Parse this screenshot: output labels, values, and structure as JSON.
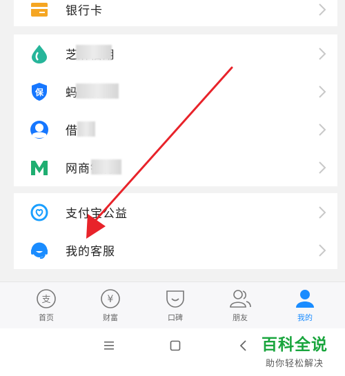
{
  "colors": {
    "accent": "#1a8cff",
    "arrow": "#e8232a",
    "watermark_green": "#19a53d"
  },
  "top_item": {
    "label": "银行卡",
    "icon": "bank-card-icon"
  },
  "services": [
    {
      "label": "芝麻信用",
      "icon": "sesame-credit-icon",
      "partially_obscured": true
    },
    {
      "label": "蚂蚁保险",
      "icon": "insurance-shield-icon",
      "partially_obscured": true
    },
    {
      "label": "借呗",
      "icon": "jiebei-icon",
      "partially_obscured": true
    },
    {
      "label": "网商银行",
      "icon": "mybank-icon",
      "partially_obscured": true
    }
  ],
  "support": [
    {
      "label": "支付宝公益",
      "icon": "charity-icon"
    },
    {
      "label": "我的客服",
      "icon": "customer-service-icon"
    }
  ],
  "tabbar": [
    {
      "label": "首页",
      "icon": "home-tab-icon",
      "active": false
    },
    {
      "label": "财富",
      "icon": "wealth-tab-icon",
      "active": false
    },
    {
      "label": "口碑",
      "icon": "koubei-tab-icon",
      "active": false
    },
    {
      "label": "朋友",
      "icon": "friends-tab-icon",
      "active": false
    },
    {
      "label": "我的",
      "icon": "me-tab-icon",
      "active": true
    }
  ],
  "system_nav": [
    "menu-icon",
    "home-square-icon",
    "back-icon"
  ],
  "watermark": {
    "title": "百科全说",
    "subtitle": "助你轻松解决"
  }
}
